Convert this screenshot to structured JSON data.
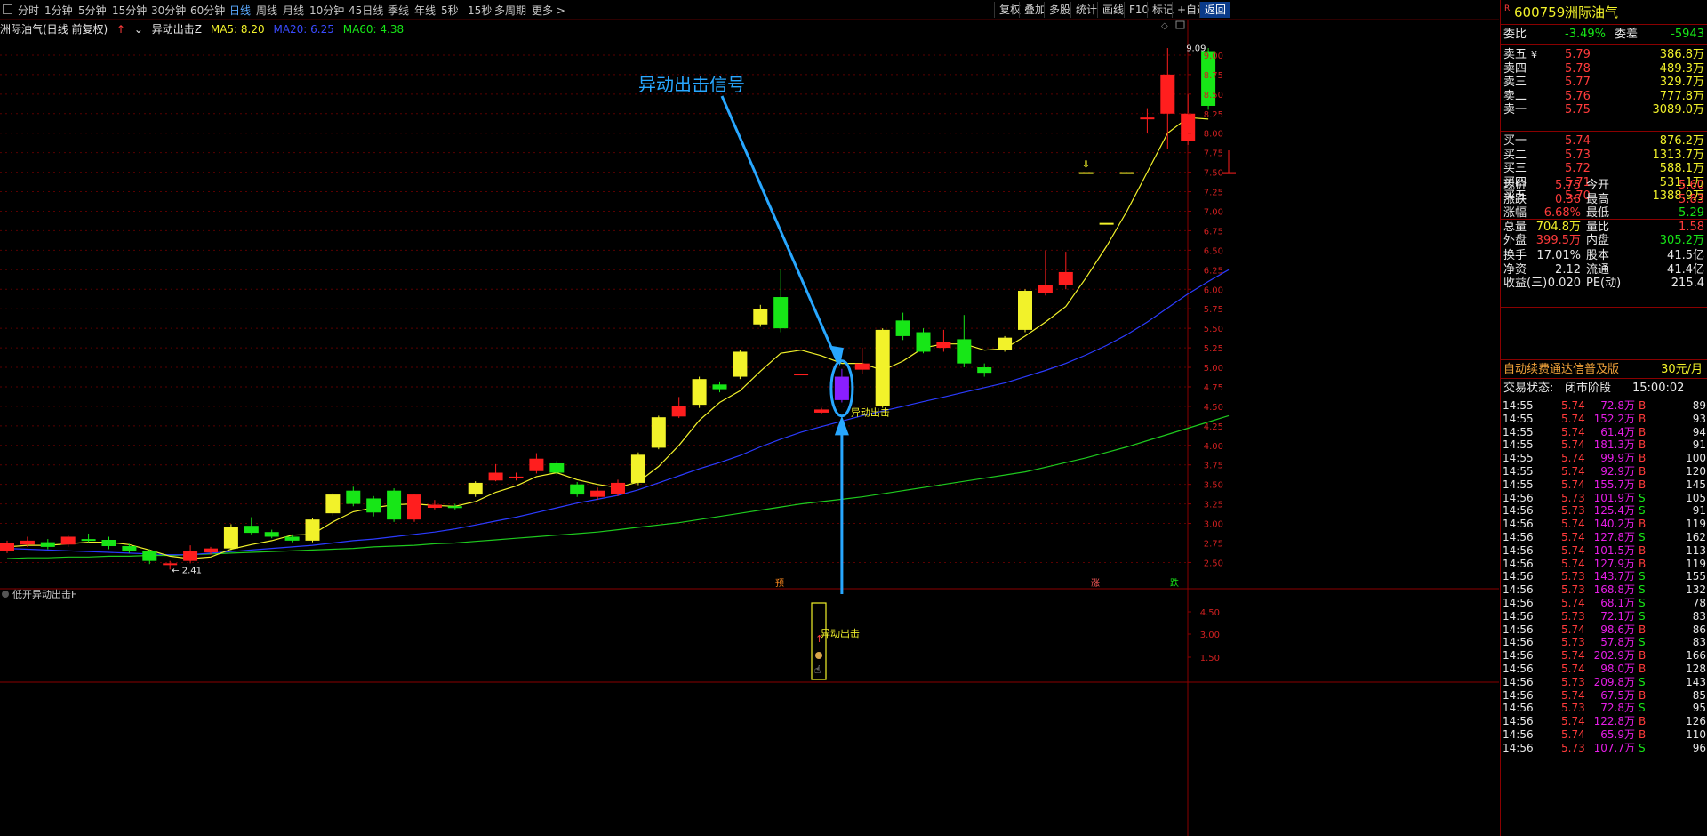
{
  "toolbar": {
    "left_items": [
      "分时",
      "1分钟",
      "5分钟",
      "15分钟",
      "30分钟",
      "60分钟",
      "日线",
      "周线",
      "月线",
      "10分钟",
      "45日线",
      "季线",
      "年线",
      "5秒",
      "15秒",
      "多周期",
      "更多 >"
    ],
    "active_left": "日线",
    "right_items": [
      "复权",
      "叠加",
      "多股",
      "统计",
      "画线",
      "F10",
      "标记",
      "+自选",
      "返回"
    ],
    "active_right": "返回"
  },
  "main_header": {
    "title": "洲际油气(日线 前复权)",
    "indicator": "异动出击Z",
    "ma5": "MA5: 8.20",
    "ma20": "MA20: 6.25",
    "ma60": "MA60: 4.38"
  },
  "annotation": {
    "callout": "异动出击信号",
    "signal_label": "异动出击",
    "low_marker": "2.41",
    "high_marker": "9.09",
    "marker_yu": "预",
    "marker_zhang": "涨",
    "marker_die": "跌"
  },
  "sub_panel": {
    "title": "低开异动出击F",
    "signal_label": "异动出击",
    "y_ticks": [
      "4.50",
      "3.00",
      "1.50"
    ]
  },
  "colors": {
    "up": "#ff1e1e",
    "down": "#17e617",
    "yellow": "#f2f22a",
    "ma20": "#2b3bff",
    "ma60": "#1ec91e",
    "callout": "#28a7ff",
    "purple": "#8a1eff"
  },
  "chart_data": {
    "type": "candlestick",
    "ylim": [
      2.3,
      9.25
    ],
    "y_ticks": [
      "9.00",
      "8.75",
      "8.50",
      "8.25",
      "8.00",
      "7.75",
      "7.50",
      "7.25",
      "7.00",
      "6.75",
      "6.50",
      "6.25",
      "6.00",
      "5.75",
      "5.50",
      "5.25",
      "5.00",
      "4.75",
      "4.50",
      "4.25",
      "4.00",
      "3.75",
      "3.50",
      "3.25",
      "3.00",
      "2.75",
      "2.50"
    ],
    "candles": [
      {
        "o": 2.65,
        "c": 2.75,
        "h": 2.78,
        "l": 2.62,
        "k": "up"
      },
      {
        "o": 2.73,
        "c": 2.78,
        "h": 2.83,
        "l": 2.7,
        "k": "up"
      },
      {
        "o": 2.76,
        "c": 2.7,
        "h": 2.8,
        "l": 2.67,
        "k": "down"
      },
      {
        "o": 2.73,
        "c": 2.83,
        "h": 2.85,
        "l": 2.7,
        "k": "up"
      },
      {
        "o": 2.8,
        "c": 2.78,
        "h": 2.87,
        "l": 2.76,
        "k": "down"
      },
      {
        "o": 2.79,
        "c": 2.71,
        "h": 2.83,
        "l": 2.67,
        "k": "down"
      },
      {
        "o": 2.71,
        "c": 2.65,
        "h": 2.74,
        "l": 2.62,
        "k": "down"
      },
      {
        "o": 2.65,
        "c": 2.52,
        "h": 2.67,
        "l": 2.48,
        "k": "down"
      },
      {
        "o": 2.49,
        "c": 2.47,
        "h": 2.52,
        "l": 2.41,
        "k": "up"
      },
      {
        "o": 2.52,
        "c": 2.65,
        "h": 2.72,
        "l": 2.49,
        "k": "up"
      },
      {
        "o": 2.63,
        "c": 2.68,
        "h": 2.7,
        "l": 2.6,
        "k": "up"
      },
      {
        "o": 2.68,
        "c": 2.95,
        "h": 2.99,
        "l": 2.66,
        "k": "yellow"
      },
      {
        "o": 2.97,
        "c": 2.88,
        "h": 3.08,
        "l": 2.86,
        "k": "down"
      },
      {
        "o": 2.89,
        "c": 2.83,
        "h": 2.92,
        "l": 2.81,
        "k": "down"
      },
      {
        "o": 2.83,
        "c": 2.78,
        "h": 2.86,
        "l": 2.76,
        "k": "down"
      },
      {
        "o": 2.78,
        "c": 3.05,
        "h": 3.07,
        "l": 2.76,
        "k": "yellow"
      },
      {
        "o": 3.13,
        "c": 3.37,
        "h": 3.39,
        "l": 3.1,
        "k": "yellow"
      },
      {
        "o": 3.42,
        "c": 3.25,
        "h": 3.47,
        "l": 3.22,
        "k": "down"
      },
      {
        "o": 3.32,
        "c": 3.14,
        "h": 3.35,
        "l": 3.09,
        "k": "down"
      },
      {
        "o": 3.42,
        "c": 3.05,
        "h": 3.45,
        "l": 3.02,
        "k": "down"
      },
      {
        "o": 3.05,
        "c": 3.37,
        "h": 3.37,
        "l": 3.02,
        "k": "up"
      },
      {
        "o": 3.24,
        "c": 3.2,
        "h": 3.3,
        "l": 3.18,
        "k": "up"
      },
      {
        "o": 3.2,
        "c": 3.22,
        "h": 3.25,
        "l": 3.18,
        "k": "down"
      },
      {
        "o": 3.37,
        "c": 3.52,
        "h": 3.54,
        "l": 3.34,
        "k": "yellow"
      },
      {
        "o": 3.55,
        "c": 3.65,
        "h": 3.76,
        "l": 3.54,
        "k": "up"
      },
      {
        "o": 3.6,
        "c": 3.6,
        "h": 3.65,
        "l": 3.55,
        "k": "up"
      },
      {
        "o": 3.67,
        "c": 3.83,
        "h": 3.9,
        "l": 3.64,
        "k": "up"
      },
      {
        "o": 3.77,
        "c": 3.65,
        "h": 3.8,
        "l": 3.62,
        "k": "down"
      },
      {
        "o": 3.5,
        "c": 3.37,
        "h": 3.53,
        "l": 3.34,
        "k": "down"
      },
      {
        "o": 3.34,
        "c": 3.42,
        "h": 3.46,
        "l": 3.3,
        "k": "up"
      },
      {
        "o": 3.38,
        "c": 3.52,
        "h": 3.56,
        "l": 3.35,
        "k": "up"
      },
      {
        "o": 3.52,
        "c": 3.88,
        "h": 3.91,
        "l": 3.49,
        "k": "yellow"
      },
      {
        "o": 3.97,
        "c": 4.36,
        "h": 4.38,
        "l": 3.95,
        "k": "yellow"
      },
      {
        "o": 4.37,
        "c": 4.5,
        "h": 4.62,
        "l": 4.35,
        "k": "up"
      },
      {
        "o": 4.52,
        "c": 4.85,
        "h": 4.88,
        "l": 4.48,
        "k": "yellow"
      },
      {
        "o": 4.78,
        "c": 4.72,
        "h": 4.82,
        "l": 4.68,
        "k": "down"
      },
      {
        "o": 4.88,
        "c": 5.2,
        "h": 5.22,
        "l": 4.85,
        "k": "yellow"
      },
      {
        "o": 5.55,
        "c": 5.75,
        "h": 5.8,
        "l": 5.52,
        "k": "yellow"
      },
      {
        "o": 5.9,
        "c": 5.5,
        "h": 6.25,
        "l": 5.45,
        "k": "down"
      },
      {
        "o": 4.92,
        "c": 4.92,
        "h": 4.92,
        "l": 4.92,
        "k": "up"
      },
      {
        "o": 4.42,
        "c": 4.46,
        "h": 4.48,
        "l": 4.4,
        "k": "up"
      },
      {
        "o": 4.88,
        "c": 4.58,
        "h": 4.98,
        "l": 4.55,
        "k": "purple"
      },
      {
        "o": 4.97,
        "c": 5.05,
        "h": 5.25,
        "l": 4.92,
        "k": "up"
      },
      {
        "o": 4.5,
        "c": 5.48,
        "h": 5.5,
        "l": 4.48,
        "k": "yellow"
      },
      {
        "o": 5.6,
        "c": 5.4,
        "h": 5.7,
        "l": 5.35,
        "k": "down"
      },
      {
        "o": 5.45,
        "c": 5.2,
        "h": 5.5,
        "l": 5.18,
        "k": "down"
      },
      {
        "o": 5.25,
        "c": 5.32,
        "h": 5.48,
        "l": 5.2,
        "k": "up"
      },
      {
        "o": 5.36,
        "c": 5.05,
        "h": 5.67,
        "l": 5.0,
        "k": "down"
      },
      {
        "o": 5.0,
        "c": 4.93,
        "h": 5.05,
        "l": 4.88,
        "k": "down"
      },
      {
        "o": 5.22,
        "c": 5.38,
        "h": 5.4,
        "l": 5.2,
        "k": "yellow"
      },
      {
        "o": 5.48,
        "c": 5.98,
        "h": 6.0,
        "l": 5.45,
        "k": "yellow"
      },
      {
        "o": 5.95,
        "c": 6.05,
        "h": 6.5,
        "l": 5.92,
        "k": "up"
      },
      {
        "o": 6.05,
        "c": 6.22,
        "h": 6.48,
        "l": 6.0,
        "k": "up"
      },
      {
        "o": 7.5,
        "c": 7.5,
        "h": 7.5,
        "l": 7.5,
        "k": "yellow"
      },
      {
        "o": 6.85,
        "c": 6.85,
        "h": 6.85,
        "l": 6.85,
        "k": "yellow"
      },
      {
        "o": 7.5,
        "c": 7.5,
        "h": 7.5,
        "l": 7.5,
        "k": "yellow"
      },
      {
        "o": 8.2,
        "c": 8.2,
        "h": 8.32,
        "l": 8.0,
        "k": "up"
      },
      {
        "o": 8.25,
        "c": 8.75,
        "h": 9.09,
        "l": 7.8,
        "k": "up"
      },
      {
        "o": 8.25,
        "c": 7.9,
        "h": 8.5,
        "l": 7.85,
        "k": "up"
      },
      {
        "o": 8.35,
        "c": 9.05,
        "h": 9.09,
        "l": 8.3,
        "k": "down"
      },
      {
        "o": 7.5,
        "c": 7.5,
        "h": 7.78,
        "l": 7.5,
        "k": "up"
      }
    ],
    "ma5": [
      2.7,
      2.72,
      2.72,
      2.74,
      2.76,
      2.76,
      2.73,
      2.66,
      2.58,
      2.55,
      2.57,
      2.67,
      2.73,
      2.78,
      2.85,
      2.86,
      3.02,
      3.15,
      3.2,
      3.24,
      3.25,
      3.23,
      3.22,
      3.28,
      3.4,
      3.48,
      3.6,
      3.65,
      3.56,
      3.5,
      3.46,
      3.53,
      3.73,
      4.0,
      4.32,
      4.55,
      4.7,
      4.95,
      5.18,
      5.22,
      5.15,
      5.05,
      5.05,
      4.96,
      5.08,
      5.25,
      5.3,
      5.3,
      5.22,
      5.24,
      5.4,
      5.58,
      5.78,
      6.15,
      6.55,
      7.0,
      7.5,
      8.0,
      8.2,
      8.18
    ],
    "ma20": [
      2.68,
      2.67,
      2.66,
      2.65,
      2.64,
      2.63,
      2.62,
      2.61,
      2.6,
      2.6,
      2.62,
      2.64,
      2.66,
      2.68,
      2.7,
      2.72,
      2.75,
      2.78,
      2.8,
      2.83,
      2.86,
      2.89,
      2.93,
      2.98,
      3.03,
      3.08,
      3.14,
      3.2,
      3.26,
      3.31,
      3.36,
      3.43,
      3.52,
      3.61,
      3.7,
      3.78,
      3.87,
      3.98,
      4.08,
      4.17,
      4.24,
      4.31,
      4.38,
      4.44,
      4.5,
      4.56,
      4.62,
      4.68,
      4.74,
      4.8,
      4.88,
      4.96,
      5.05,
      5.16,
      5.28,
      5.42,
      5.58,
      5.76,
      5.94,
      6.1,
      6.25
    ],
    "ma60": [
      2.55,
      2.56,
      2.56,
      2.57,
      2.57,
      2.58,
      2.58,
      2.59,
      2.59,
      2.6,
      2.61,
      2.62,
      2.63,
      2.64,
      2.65,
      2.66,
      2.67,
      2.68,
      2.7,
      2.71,
      2.72,
      2.74,
      2.75,
      2.77,
      2.79,
      2.81,
      2.83,
      2.85,
      2.87,
      2.89,
      2.92,
      2.95,
      2.98,
      3.01,
      3.05,
      3.09,
      3.13,
      3.17,
      3.21,
      3.25,
      3.28,
      3.31,
      3.34,
      3.38,
      3.42,
      3.46,
      3.5,
      3.54,
      3.58,
      3.62,
      3.66,
      3.72,
      3.78,
      3.84,
      3.91,
      3.98,
      4.06,
      4.14,
      4.22,
      4.3,
      4.38
    ]
  },
  "quote": {
    "code": "600759",
    "name": "洲际油气",
    "weibi_label": "委比",
    "weibi": "-3.49%",
    "weicha_label": "委差",
    "weicha": "-5943",
    "asks": [
      {
        "label": "卖五",
        "flag": "¥",
        "price": "5.79",
        "vol": "386.8万"
      },
      {
        "label": "卖四",
        "flag": "",
        "price": "5.78",
        "vol": "489.3万"
      },
      {
        "label": "卖三",
        "flag": "",
        "price": "5.77",
        "vol": "329.7万"
      },
      {
        "label": "卖二",
        "flag": "",
        "price": "5.76",
        "vol": "777.8万"
      },
      {
        "label": "卖一",
        "flag": "",
        "price": "5.75",
        "vol": "3089.0万"
      }
    ],
    "bids": [
      {
        "label": "买一",
        "price": "5.74",
        "vol": "876.2万"
      },
      {
        "label": "买二",
        "price": "5.73",
        "vol": "1313.7万"
      },
      {
        "label": "买三",
        "price": "5.72",
        "vol": "588.1万"
      },
      {
        "label": "买四",
        "price": "5.71",
        "vol": "531.1万"
      },
      {
        "label": "买五",
        "price": "5.70",
        "vol": "1388.9万"
      }
    ],
    "stats": [
      {
        "l1": "现价",
        "v1": "5.75",
        "c1": "red",
        "l2": "今开",
        "v2": "5.60",
        "c2": "red"
      },
      {
        "l1": "涨跌",
        "v1": "0.36",
        "c1": "red",
        "l2": "最高",
        "v2": "5.83",
        "c2": "red"
      },
      {
        "l1": "涨幅",
        "v1": "6.68%",
        "c1": "red",
        "l2": "最低",
        "v2": "5.29",
        "c2": "green"
      },
      {
        "l1": "总量",
        "v1": "704.8万",
        "c1": "yellow",
        "l2": "量比",
        "v2": "1.58",
        "c2": "red"
      },
      {
        "l1": "外盘",
        "v1": "399.5万",
        "c1": "red",
        "l2": "内盘",
        "v2": "305.2万",
        "c2": "green"
      }
    ],
    "stats2": [
      {
        "l1": "换手",
        "v1": "17.01%",
        "l2": "股本",
        "v2": "41.5亿"
      },
      {
        "l1": "净资",
        "v1": "2.12",
        "l2": "流通",
        "v2": "41.4亿"
      },
      {
        "l1": "收益(三)",
        "v1": "0.020",
        "l2": "PE(动)",
        "v2": "215.4"
      }
    ],
    "promo": "自动续费通达信普及版",
    "promo_price": "30元/月",
    "status_label": "交易状态:",
    "status_value": "闭市阶段",
    "status_time": "15:00:02"
  },
  "ticks": [
    {
      "t": "14:55",
      "p": "5.74",
      "v": "72.8万",
      "s": "B",
      "n": "89"
    },
    {
      "t": "14:55",
      "p": "5.74",
      "v": "152.2万",
      "s": "B",
      "n": "93"
    },
    {
      "t": "14:55",
      "p": "5.74",
      "v": "61.4万",
      "s": "B",
      "n": "94"
    },
    {
      "t": "14:55",
      "p": "5.74",
      "v": "181.3万",
      "s": "B",
      "n": "91"
    },
    {
      "t": "14:55",
      "p": "5.74",
      "v": "99.9万",
      "s": "B",
      "n": "100"
    },
    {
      "t": "14:55",
      "p": "5.74",
      "v": "92.9万",
      "s": "B",
      "n": "120"
    },
    {
      "t": "14:55",
      "p": "5.74",
      "v": "155.7万",
      "s": "B",
      "n": "145"
    },
    {
      "t": "14:56",
      "p": "5.73",
      "v": "101.9万",
      "s": "S",
      "n": "105"
    },
    {
      "t": "14:56",
      "p": "5.73",
      "v": "125.4万",
      "s": "S",
      "n": "91"
    },
    {
      "t": "14:56",
      "p": "5.74",
      "v": "140.2万",
      "s": "B",
      "n": "119"
    },
    {
      "t": "14:56",
      "p": "5.74",
      "v": "127.8万",
      "s": "S",
      "n": "162"
    },
    {
      "t": "14:56",
      "p": "5.74",
      "v": "101.5万",
      "s": "B",
      "n": "113"
    },
    {
      "t": "14:56",
      "p": "5.74",
      "v": "127.9万",
      "s": "B",
      "n": "119"
    },
    {
      "t": "14:56",
      "p": "5.73",
      "v": "143.7万",
      "s": "S",
      "n": "155"
    },
    {
      "t": "14:56",
      "p": "5.73",
      "v": "168.8万",
      "s": "S",
      "n": "132"
    },
    {
      "t": "14:56",
      "p": "5.74",
      "v": "68.1万",
      "s": "S",
      "n": "78"
    },
    {
      "t": "14:56",
      "p": "5.73",
      "v": "72.1万",
      "s": "S",
      "n": "83"
    },
    {
      "t": "14:56",
      "p": "5.74",
      "v": "98.6万",
      "s": "B",
      "n": "86"
    },
    {
      "t": "14:56",
      "p": "5.73",
      "v": "57.8万",
      "s": "S",
      "n": "83"
    },
    {
      "t": "14:56",
      "p": "5.74",
      "v": "202.9万",
      "s": "B",
      "n": "166"
    },
    {
      "t": "14:56",
      "p": "5.74",
      "v": "98.0万",
      "s": "B",
      "n": "128"
    },
    {
      "t": "14:56",
      "p": "5.73",
      "v": "209.8万",
      "s": "S",
      "n": "143"
    },
    {
      "t": "14:56",
      "p": "5.74",
      "v": "67.5万",
      "s": "B",
      "n": "85"
    },
    {
      "t": "14:56",
      "p": "5.73",
      "v": "72.8万",
      "s": "S",
      "n": "95"
    },
    {
      "t": "14:56",
      "p": "5.74",
      "v": "122.8万",
      "s": "B",
      "n": "126"
    },
    {
      "t": "14:56",
      "p": "5.74",
      "v": "65.9万",
      "s": "B",
      "n": "110"
    },
    {
      "t": "14:56",
      "p": "5.73",
      "v": "107.7万",
      "s": "S",
      "n": "96"
    }
  ]
}
